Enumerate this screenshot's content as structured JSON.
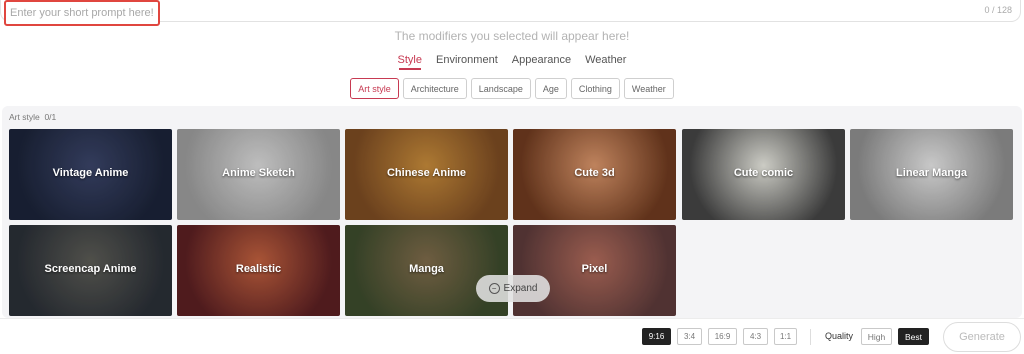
{
  "prompt": {
    "placeholder": "Enter your short prompt here!",
    "counter": "0 / 128"
  },
  "modifiers_hint": "The modifiers you selected will appear here!",
  "tabs": [
    {
      "label": "Style",
      "active": true
    },
    {
      "label": "Environment",
      "active": false
    },
    {
      "label": "Appearance",
      "active": false
    },
    {
      "label": "Weather",
      "active": false
    }
  ],
  "chips": [
    {
      "label": "Art style",
      "active": true
    },
    {
      "label": "Architecture",
      "active": false
    },
    {
      "label": "Landscape",
      "active": false
    },
    {
      "label": "Age",
      "active": false
    },
    {
      "label": "Clothing",
      "active": false
    },
    {
      "label": "Weather",
      "active": false
    }
  ],
  "gallery": {
    "section_label": "Art style",
    "selected_count": "0/1",
    "cards": [
      {
        "label": "Vintage Anime",
        "colors": [
          "#1b2338",
          "#3a4468"
        ]
      },
      {
        "label": "Anime Sketch",
        "colors": [
          "#9a9a9a",
          "#d8d8d8"
        ]
      },
      {
        "label": "Chinese Anime",
        "colors": [
          "#7a4a22",
          "#c58a3a"
        ]
      },
      {
        "label": "Cute 3d",
        "colors": [
          "#6e3a1f",
          "#d9956a"
        ]
      },
      {
        "label": "Cute comic",
        "colors": [
          "#444444",
          "#e8e8e0"
        ]
      },
      {
        "label": "Linear Manga",
        "colors": [
          "#8d8d8d",
          "#e4e4e4"
        ]
      },
      {
        "label": "Screencap Anime",
        "colors": [
          "#2a2f36",
          "#5b5b55"
        ]
      },
      {
        "label": "Realistic",
        "colors": [
          "#5a1f22",
          "#c0603e"
        ]
      },
      {
        "label": "Manga",
        "colors": [
          "#3c4a2c",
          "#7e6a4a"
        ]
      },
      {
        "label": "Pixel",
        "colors": [
          "#5c3a3a",
          "#b06a5a"
        ]
      }
    ],
    "expand_label": "Expand"
  },
  "aspect_ratios": [
    {
      "label": "9:16",
      "active": true
    },
    {
      "label": "3:4",
      "active": false
    },
    {
      "label": "16:9",
      "active": false
    },
    {
      "label": "4:3",
      "active": false
    },
    {
      "label": "1:1",
      "active": false
    }
  ],
  "quality": {
    "label": "Quality",
    "options": [
      {
        "label": "High",
        "active": false
      },
      {
        "label": "Best",
        "active": true
      }
    ]
  },
  "generate_label": "Generate",
  "icons": {
    "expand": "minus-circle-icon"
  },
  "accent_color": "#c73a52"
}
